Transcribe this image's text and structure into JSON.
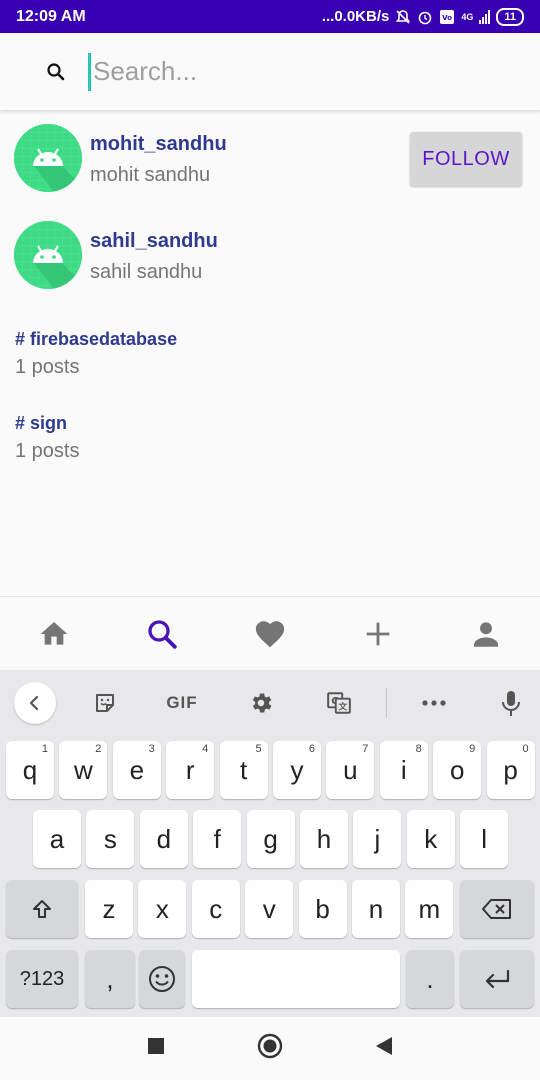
{
  "status_bar": {
    "time": "12:09 AM",
    "speed": "...0.0KB/s",
    "network_label": "4G",
    "battery": "11"
  },
  "search": {
    "placeholder": "Search..."
  },
  "users": [
    {
      "username": "mohit_sandhu",
      "fullname": "mohit sandhu",
      "follow_label": "FOLLOW"
    },
    {
      "username": "sahil_sandhu",
      "fullname": "sahil sandhu"
    }
  ],
  "tags": [
    {
      "name": "# firebasedatabase",
      "count": "1 posts"
    },
    {
      "name": "# sign",
      "count": "1 posts"
    }
  ],
  "bottom_nav": [
    "home-icon",
    "search-icon",
    "heart-icon",
    "add-icon",
    "profile-icon"
  ],
  "keyboard": {
    "toolbar": {
      "gif": "GIF"
    },
    "row1": [
      {
        "k": "q",
        "h": "1"
      },
      {
        "k": "w",
        "h": "2"
      },
      {
        "k": "e",
        "h": "3"
      },
      {
        "k": "r",
        "h": "4"
      },
      {
        "k": "t",
        "h": "5"
      },
      {
        "k": "y",
        "h": "6"
      },
      {
        "k": "u",
        "h": "7"
      },
      {
        "k": "i",
        "h": "8"
      },
      {
        "k": "o",
        "h": "9"
      },
      {
        "k": "p",
        "h": "0"
      }
    ],
    "row2": [
      "a",
      "s",
      "d",
      "f",
      "g",
      "h",
      "j",
      "k",
      "l"
    ],
    "row3": [
      "z",
      "x",
      "c",
      "v",
      "b",
      "n",
      "m"
    ],
    "symbols_label": "?123",
    "comma": ",",
    "period": "."
  },
  "colors": {
    "status_bar": "#3700b3",
    "accent": "#5a16c8",
    "link": "#2f3a8f",
    "android_green": "#3ddc84"
  }
}
